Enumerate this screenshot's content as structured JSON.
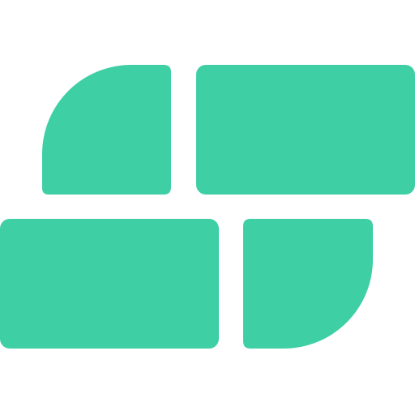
{
  "logo": {
    "name": "four-tile-logo",
    "color": "#3ecfa5",
    "background": "#ffffff",
    "tiles": [
      {
        "name": "tile-top-left",
        "shape": "rounded-quarter"
      },
      {
        "name": "tile-top-right",
        "shape": "rounded-rectangle"
      },
      {
        "name": "tile-bottom-left",
        "shape": "rounded-rectangle"
      },
      {
        "name": "tile-bottom-right",
        "shape": "rounded-quarter"
      }
    ]
  }
}
